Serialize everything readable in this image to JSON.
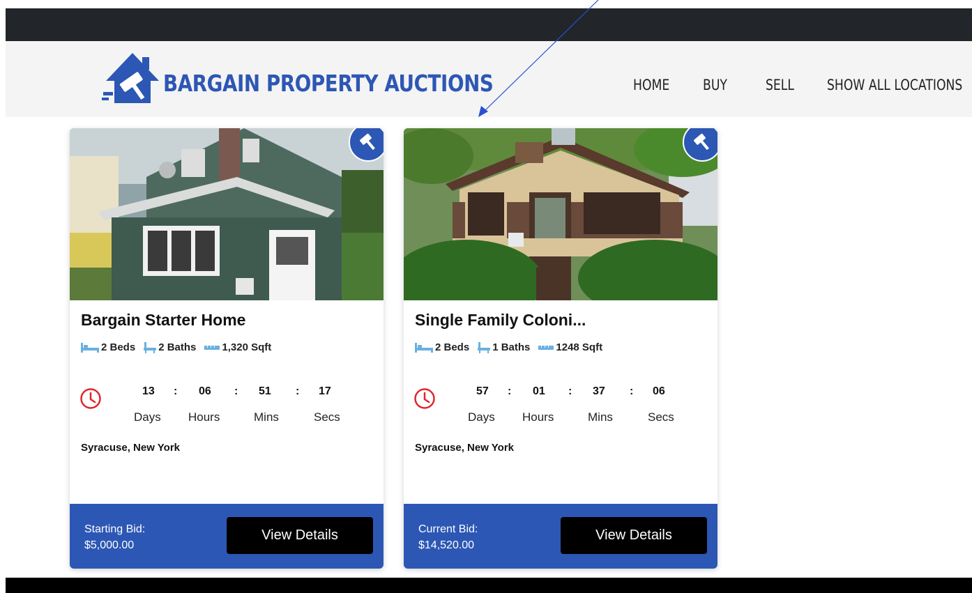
{
  "brand": {
    "name": "BARGAIN PROPERTY AUCTIONS",
    "color": "#2d57b4"
  },
  "nav": {
    "items": [
      "HOME",
      "BUY",
      "SELL",
      "SHOW ALL LOCATIONS"
    ]
  },
  "icons": {
    "badge": "gavel-icon",
    "beds": "bed-icon",
    "baths": "bath-icon",
    "area": "area-icon",
    "timer": "clock-icon"
  },
  "listings": [
    {
      "title": "Bargain Starter Home",
      "beds": "2 Beds",
      "baths": "2 Baths",
      "sqft": "1,320 Sqft",
      "countdown": {
        "days": "13",
        "hours": "06",
        "mins": "51",
        "secs": "17",
        "sep": ":"
      },
      "countdown_labels": {
        "days": "Days",
        "hours": "Hours",
        "mins": "Mins",
        "secs": "Secs"
      },
      "location": "Syracuse, New York",
      "bid_label": "Starting Bid:",
      "bid_value": "$5,000.00",
      "button": "View Details"
    },
    {
      "title": "Single Family Coloni...",
      "beds": "2 Beds",
      "baths": "1 Baths",
      "sqft": "1248 Sqft",
      "countdown": {
        "days": "57",
        "hours": "01",
        "mins": "37",
        "secs": "06",
        "sep": ":"
      },
      "countdown_labels": {
        "days": "Days",
        "hours": "Hours",
        "mins": "Mins",
        "secs": "Secs"
      },
      "location": "Syracuse, New York",
      "bid_label": "Current Bid:",
      "bid_value": "$14,520.00",
      "button": "View Details"
    }
  ],
  "colors": {
    "topbar": "#22262a",
    "header": "#f4f4f4",
    "accent": "#2d57b4",
    "clock": "#e0262c",
    "button": "#000000"
  }
}
